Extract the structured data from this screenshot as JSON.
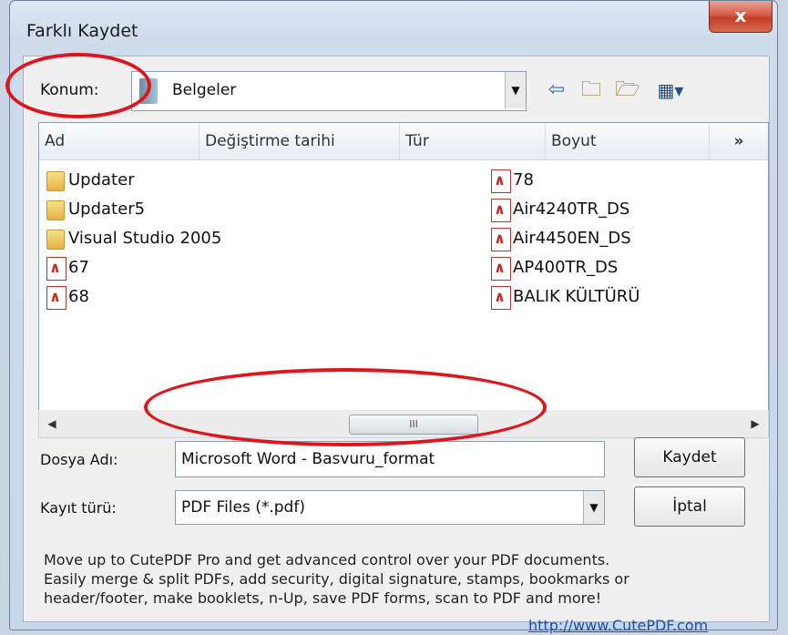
{
  "window": {
    "title": "Farklı Kaydet",
    "close_label": "x"
  },
  "location": {
    "label": "Konum:",
    "value": "Belgeler"
  },
  "toolbar": {
    "icons": [
      "back-arrow-icon",
      "up-folder-icon",
      "new-folder-icon",
      "view-menu-icon"
    ]
  },
  "list": {
    "columns": [
      "Ad",
      "Değiştirme tarihi",
      "Tür",
      "Boyut"
    ],
    "more_label": "»",
    "left_items": [
      {
        "name": "Updater",
        "type": "folder"
      },
      {
        "name": "Updater5",
        "type": "folder"
      },
      {
        "name": "Visual Studio 2005",
        "type": "folder"
      },
      {
        "name": "67",
        "type": "pdf"
      },
      {
        "name": "68",
        "type": "pdf"
      }
    ],
    "right_items": [
      {
        "name": "78",
        "type": "pdf"
      },
      {
        "name": "Air4240TR_DS",
        "type": "pdf"
      },
      {
        "name": "Air4450EN_DS",
        "type": "pdf"
      },
      {
        "name": "AP400TR_DS",
        "type": "pdf"
      },
      {
        "name": "BALIK KÜLTÜRÜ",
        "type": "pdf"
      }
    ]
  },
  "scrollbar": {
    "thumb_grip": "III"
  },
  "filename": {
    "label": "Dosya Adı:",
    "value": "Microsoft Word - Basvuru_format"
  },
  "filetype": {
    "label": "Kayıt türü:",
    "value": "PDF Files (*.pdf)"
  },
  "buttons": {
    "save": "Kaydet",
    "cancel": "İptal"
  },
  "promo": {
    "lines": [
      "Move up to CutePDF Pro and get advanced control over your PDF documents.",
      "Easily merge & split PDFs, add security, digital signature, stamps, bookmarks or",
      "header/footer, make booklets, n-Up, save PDF forms, scan to PDF and more!"
    ],
    "link": "http://www.CutePDF.com"
  },
  "colors": {
    "annotation_red": "#e0151b",
    "link_blue": "#1a4fb5"
  }
}
